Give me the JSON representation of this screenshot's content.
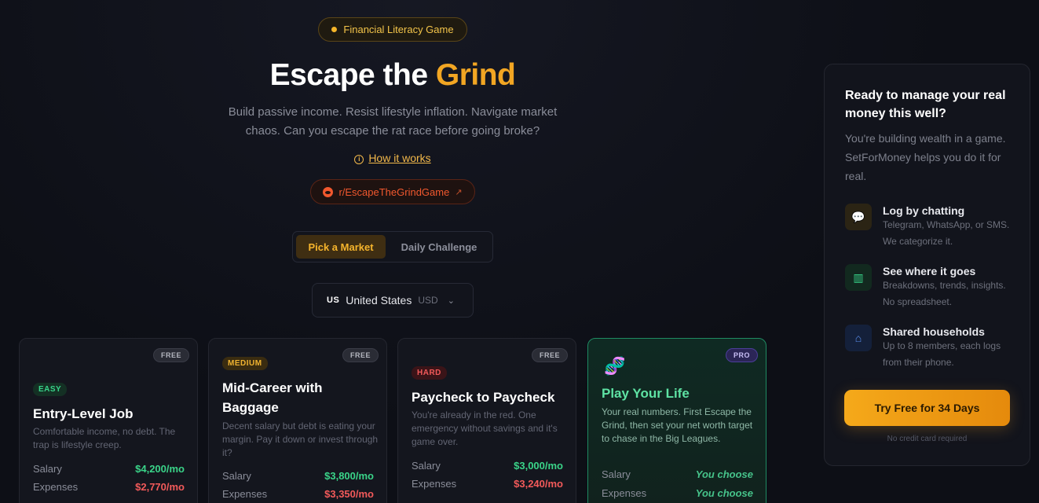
{
  "hero": {
    "tag": "Financial Literacy Game",
    "title_main": "Escape the",
    "title_accent": "Grind",
    "subtitle": "Build passive income. Resist lifestyle inflation. Navigate market chaos. Can you escape the rat race before going broke?",
    "how_link": "How it works",
    "reddit": "r/EscapeTheGrindGame"
  },
  "modes": {
    "pick_market": "Pick a Market",
    "daily_challenge": "Daily Challenge",
    "active": "pick_market"
  },
  "market": {
    "flag": "US",
    "country": "United States",
    "currency": "USD"
  },
  "cards": [
    {
      "badge": "FREE",
      "difficulty": "EASY",
      "title": "Entry-Level Job",
      "desc": "Comfortable income, no debt. The trap is lifestyle creep.",
      "salary_label": "Salary",
      "salary": "$4,200/mo",
      "expenses_label": "Expenses",
      "expenses": "$2,770/mo"
    },
    {
      "badge": "FREE",
      "difficulty": "MEDIUM",
      "title": "Mid-Career with Baggage",
      "desc": "Decent salary but debt is eating your margin. Pay it down or invest through it?",
      "salary_label": "Salary",
      "salary": "$3,800/mo",
      "expenses_label": "Expenses",
      "expenses": "$3,350/mo"
    },
    {
      "badge": "FREE",
      "difficulty": "HARD",
      "title": "Paycheck to Paycheck",
      "desc": "You're already in the red. One emergency without savings and it's game over.",
      "salary_label": "Salary",
      "salary": "$3,000/mo",
      "expenses_label": "Expenses",
      "expenses": "$3,240/mo"
    },
    {
      "badge": "PRO",
      "icon": "dna-icon",
      "title": "Play Your Life",
      "desc": "Your real numbers. First Escape the Grind, then set your net worth target to chase in the Big Leagues.",
      "salary_label": "Salary",
      "salary": "You choose",
      "expenses_label": "Expenses",
      "expenses": "You choose"
    }
  ],
  "promo": {
    "title": "Ready to manage your real money this well?",
    "subtitle": "You're building wealth in a game. SetForMoney helps you do it for real.",
    "features": [
      {
        "icon": "chat-icon",
        "title": "Log by chatting",
        "desc": "Telegram, WhatsApp, or SMS. We categorize it."
      },
      {
        "icon": "bar-chart-icon",
        "title": "See where it goes",
        "desc": "Breakdowns, trends, insights. No spreadsheet."
      },
      {
        "icon": "household-icon",
        "title": "Shared households",
        "desc": "Up to 8 members, each logs from their phone."
      }
    ],
    "cta": "Try Free for 34 Days",
    "cta_note": "No credit card required"
  },
  "colors": {
    "accent": "#f2a623",
    "green": "#3ad489",
    "red": "#f25a5a",
    "background": "#0d0f16"
  }
}
